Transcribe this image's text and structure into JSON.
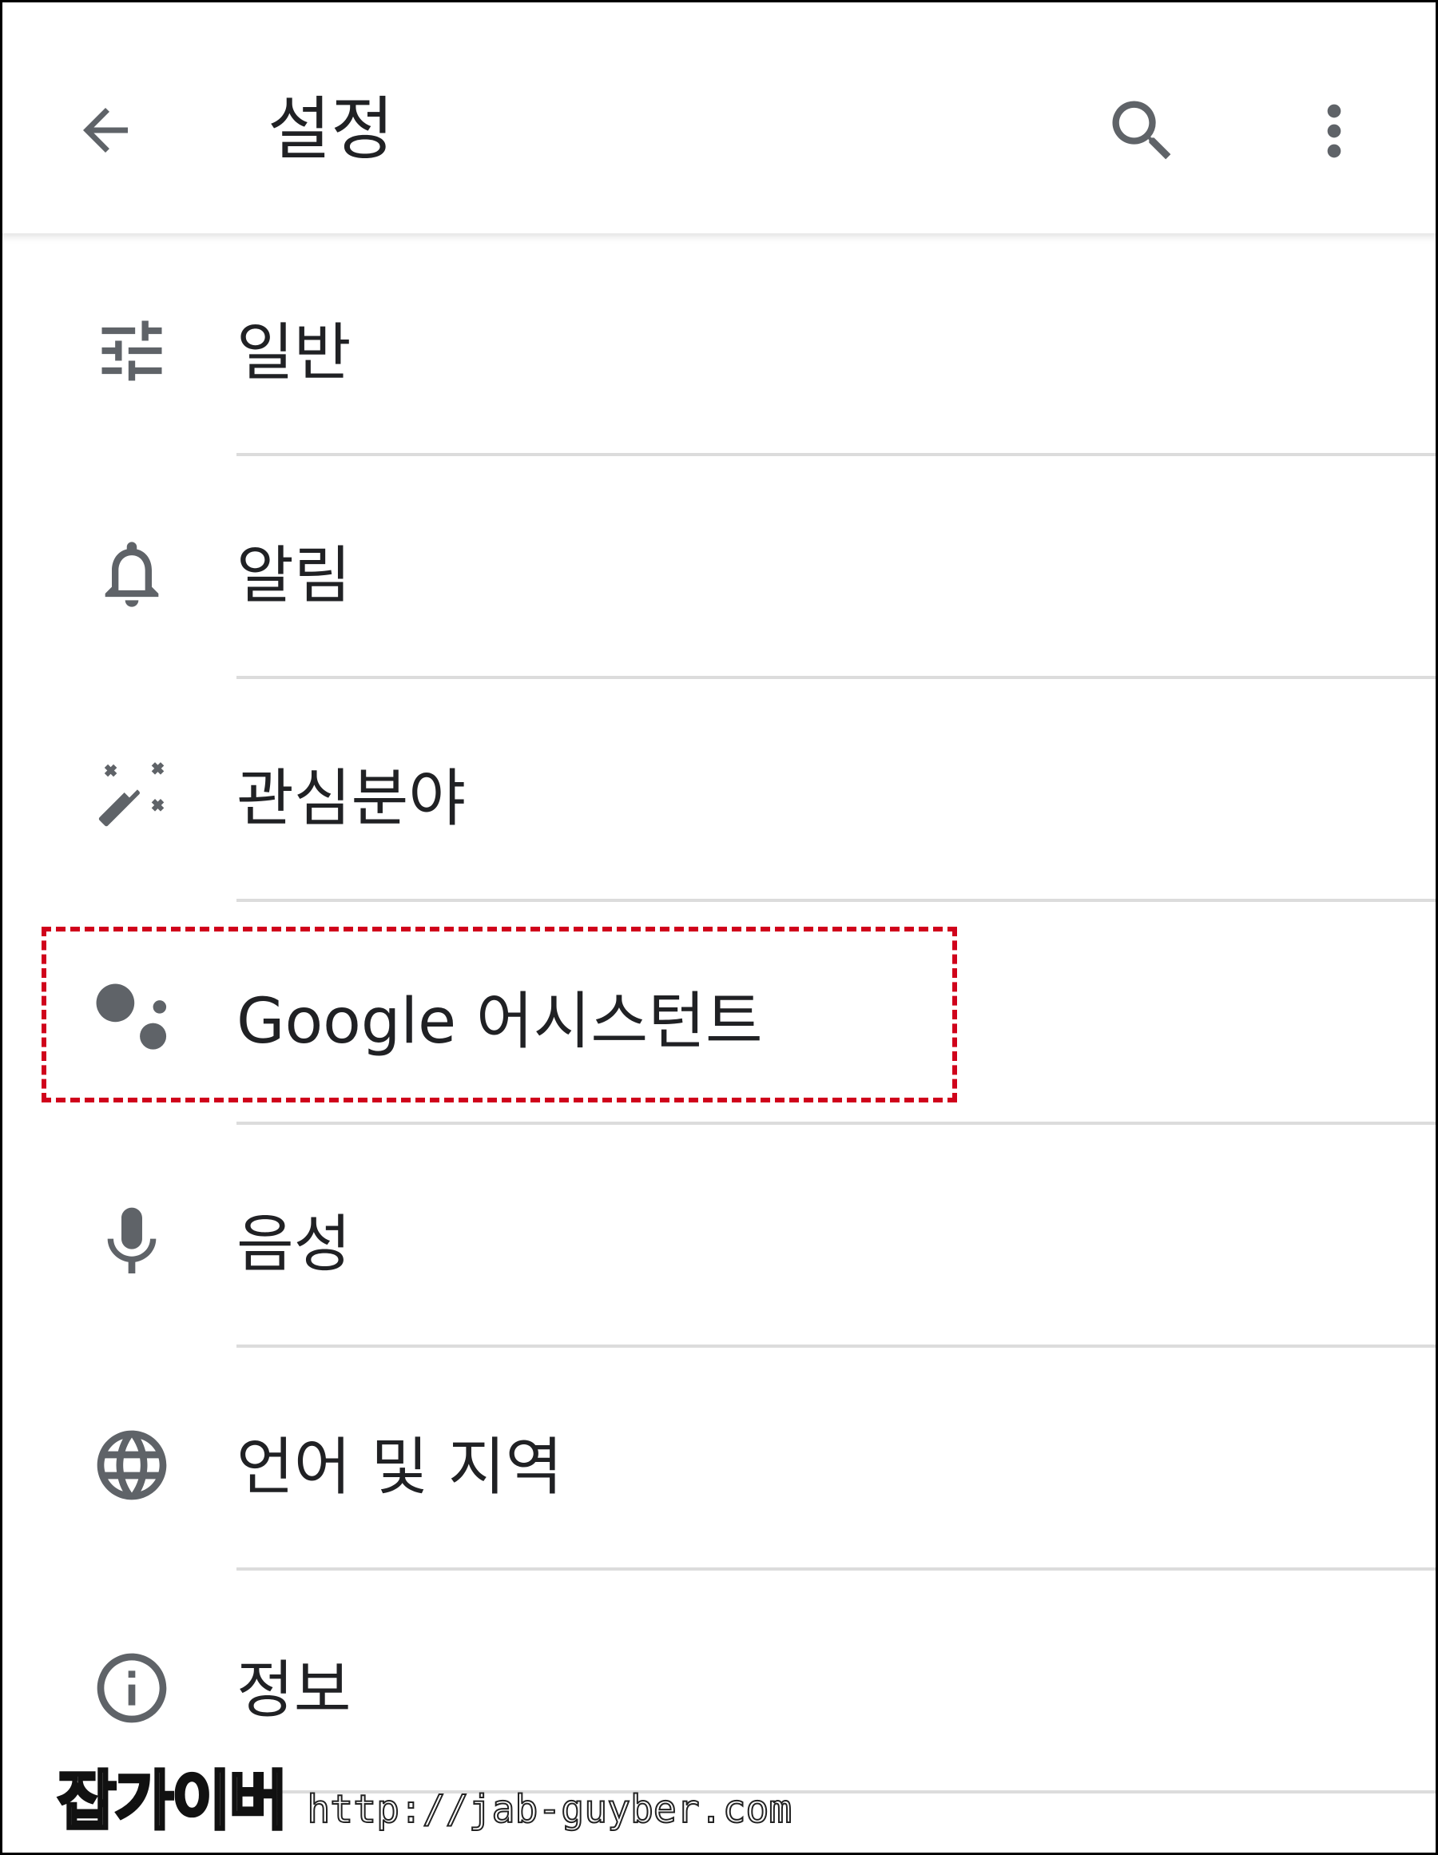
{
  "app_bar": {
    "title": "설정",
    "back_icon": "arrow-back-icon",
    "search_icon": "search-icon",
    "more_icon": "more-vert-icon"
  },
  "settings": {
    "items": [
      {
        "label": "일반",
        "icon": "tune-icon"
      },
      {
        "label": "알림",
        "icon": "bell-icon"
      },
      {
        "label": "관심분야",
        "icon": "magic-wand-icon"
      },
      {
        "label": "Google 어시스턴트",
        "icon": "google-assistant-icon",
        "highlighted": true
      },
      {
        "label": "음성",
        "icon": "mic-icon"
      },
      {
        "label": "언어 및 지역",
        "icon": "globe-icon"
      },
      {
        "label": "정보",
        "icon": "info-icon"
      }
    ]
  },
  "colors": {
    "icon": "#5f6368",
    "text": "#202124",
    "divider": "#dcdcdc",
    "highlight": "#d0021b"
  },
  "watermark": {
    "logo": "잡가이버",
    "url": "http://jab-guyber.com"
  }
}
